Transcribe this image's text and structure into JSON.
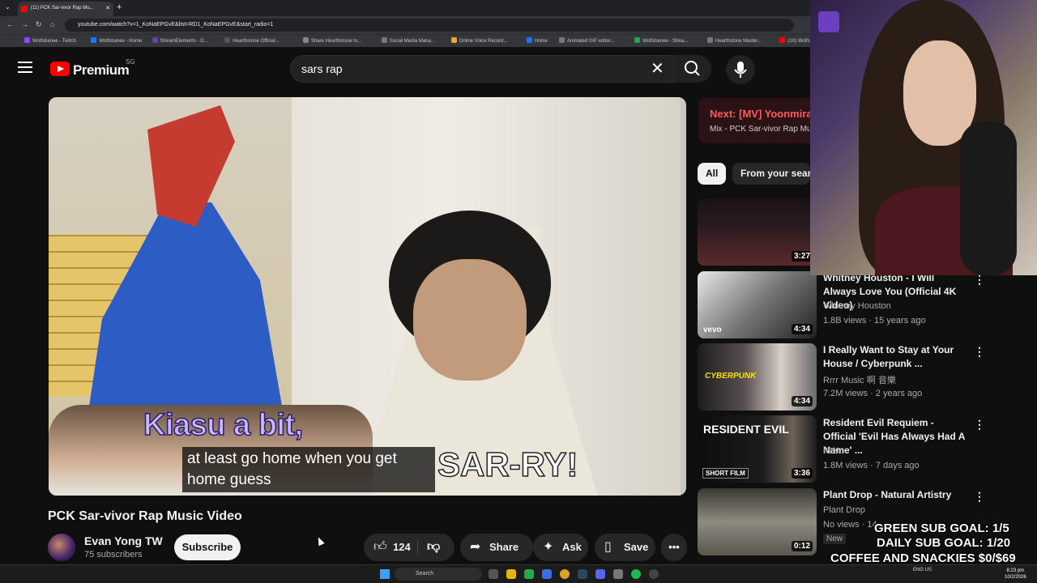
{
  "browser": {
    "tab_title": "(11) PCK Sar-vivor Rap Mu...",
    "url": "youtube.com/watch?v=1_KoNaEPGvE&list=RD1_KoNaEPGvE&start_radio=1",
    "bookmarks": [
      "Wolfsbanee - Twitch",
      "Wolfsbanee - Home",
      "StreamElements - D...",
      "Hearthstone Official...",
      "Share Hearthstone to...",
      "Social Media Mana...",
      "Online Voice Record...",
      "Home",
      "Animated GIF editor...",
      "Wolfsbanee - Strea...",
      "Hearthstone Master...",
      "(10) Wolfsbanee - Y...",
      "MHWilds Weakness...",
      "Ad"
    ]
  },
  "header": {
    "logo_text": "Premium",
    "country_code": "SG",
    "search_value": "sars rap"
  },
  "video": {
    "burned_text_1": "Kiasu a bit,",
    "burned_text_2": "SAR-RY!",
    "caption_line_1": "at least go home when you get",
    "caption_line_2": "home guess",
    "title": "PCK Sar-vivor Rap Music Video"
  },
  "owner": {
    "channel": "Evan Yong TW",
    "subscribers": "75 subscribers",
    "subscribe_label": "Subscribe"
  },
  "actions": {
    "likes": "124",
    "share": "Share",
    "ask": "Ask",
    "save": "Save"
  },
  "sidebar": {
    "next_label": "Next: [MV] Yoonmirae(",
    "mix_label": "Mix - PCK Sar-vivor Rap Mu",
    "chips": [
      "All",
      "From your search"
    ],
    "videos": [
      {
        "title": "",
        "channel": "",
        "meta": "",
        "duration": "3:27"
      },
      {
        "title": "Whitney Houston - I Will Always Love You (Official 4K Video)",
        "channel": "Whitney Houston",
        "meta": "1.8B views · 15 years ago",
        "duration": "4:34",
        "overlay": "vevo"
      },
      {
        "title": "I Really Want to Stay at Your House / Cyberpunk ...",
        "channel": "Rrrr Music 啊 音樂",
        "meta": "7.2M views · 2 years ago",
        "duration": "4:34",
        "overlay": "CYBERPUNK"
      },
      {
        "title": "Resident Evil Requiem - Official 'Evil Has Always Had A Name' ...",
        "channel": "IGN",
        "meta": "1.8M views · 7 days ago",
        "duration": "3:36",
        "overlay": "SHORT FILM",
        "overlay2": "RESIDENT EVIL"
      },
      {
        "title": "Plant Drop - Natural Artistry",
        "channel": "Plant Drop",
        "meta": "No views · 14...",
        "duration": "0:12",
        "badge": "New"
      }
    ]
  },
  "stream_overlay": {
    "green_goal": "GREEN SUB GOAL: 1/5",
    "daily_goal": "DAILY SUB GOAL: 1/20",
    "coffee_goal": "COFFEE AND SNACKIES $0/$69"
  },
  "taskbar": {
    "search_placeholder": "Search",
    "lang": "ENG US",
    "time": "8:23 pm",
    "date": "10/2/2026"
  },
  "colors": {
    "background": "#0f0f0f",
    "brand_red": "#ff0000",
    "pill": "#272727"
  }
}
